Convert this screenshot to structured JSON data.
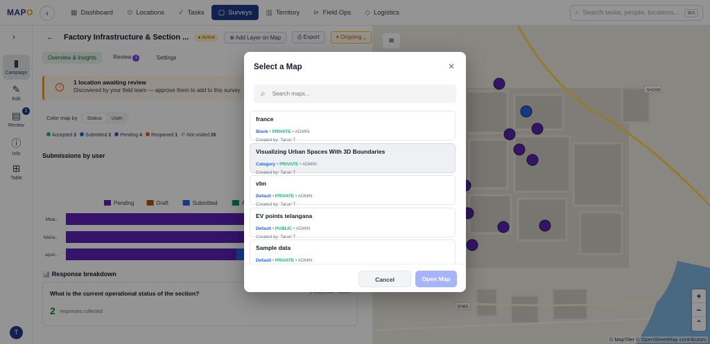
{
  "app": {
    "logo": "MAP",
    "logo_accent": "O"
  },
  "nav": {
    "items": [
      {
        "label": "Dashboard",
        "icon": "dashboard-icon",
        "glyph": "▦"
      },
      {
        "label": "Locations",
        "icon": "pin-icon",
        "glyph": "⊙"
      },
      {
        "label": "Tasks",
        "icon": "tasks-icon",
        "glyph": "✓"
      },
      {
        "label": "Surveys",
        "icon": "clipboard-icon",
        "glyph": "▢"
      },
      {
        "label": "Territory",
        "icon": "map-icon",
        "glyph": "▥"
      },
      {
        "label": "Field Ops",
        "icon": "field-ops-icon",
        "glyph": "⊳"
      },
      {
        "label": "Logistics",
        "icon": "cube-icon",
        "glyph": "◇"
      }
    ],
    "active": "Surveys",
    "search_placeholder": "Search tasks, people, locations...",
    "shortcut": "⌘K"
  },
  "rail": {
    "items": [
      {
        "label": "Campaign",
        "glyph": "▮"
      },
      {
        "label": "Edit",
        "glyph": "✎"
      },
      {
        "label": "Review",
        "glyph": "▤",
        "badge": "1"
      },
      {
        "label": "Info",
        "glyph": "ⓘ"
      },
      {
        "label": "Table",
        "glyph": "⊞"
      }
    ],
    "avatar": "T"
  },
  "survey": {
    "title": "Factory Infrastructure & Section ...",
    "status": "● Active",
    "add_layer": "⊕ Add Layer on Map",
    "export": "⎙ Export",
    "ongoing": "⏸ Ongoing ⌄",
    "tabs": {
      "overview": "Overview & insights",
      "review": "Review",
      "review_count": "1",
      "settings": "Settings"
    },
    "alert_title": "1 location awaiting review",
    "alert_text": "Discovered by your field team — approve them to add to this survey.",
    "color_map_label": "Color map by",
    "color_map_status": "Status",
    "color_map_user": "User",
    "legend": [
      {
        "label": "Accepted",
        "count": "3",
        "color": "#10b981"
      },
      {
        "label": "Submitted",
        "count": "2",
        "color": "#2563eb"
      },
      {
        "label": "Pending",
        "count": "4",
        "color": "#7c3aed"
      },
      {
        "label": "Reopened",
        "count": "1",
        "color": "#ea580c"
      },
      {
        "label": "Not visited",
        "count": "26",
        "color": "#d1d5db"
      }
    ],
    "submissions_title": "Submissions by user",
    "response_title": "📊 Response breakdown",
    "question": "What is the current operational status of the section?",
    "question_meta": "2 responses · select",
    "responses_count": "2",
    "responses_label": "responses collected"
  },
  "chart_data": {
    "type": "bar",
    "orientation": "horizontal",
    "stacked": true,
    "categories": [
      "Mital..",
      "Nisha..",
      "epsri.."
    ],
    "series": [
      {
        "name": "Pending",
        "color": "#5b21b6",
        "values": [
          5,
          5,
          3
        ]
      },
      {
        "name": "Draft",
        "color": "#b45309",
        "values": [
          0,
          0,
          0
        ]
      },
      {
        "name": "Submitted",
        "color": "#2563eb",
        "values": [
          0,
          0,
          1
        ]
      },
      {
        "name": "Accepted",
        "color": "#059669",
        "values": [
          0,
          0,
          0
        ]
      }
    ],
    "x_ticks": [
      "0",
      "1",
      "2",
      "3"
    ],
    "xlim": [
      0,
      5
    ],
    "legend": "top"
  },
  "modal": {
    "title": "Select a Map",
    "search_placeholder": "Search maps...",
    "items": [
      {
        "name": "france",
        "type": "Blank",
        "visibility": "PRIVATE",
        "role": "ADMIN",
        "created": "Created by: Tarun T",
        "selected": false
      },
      {
        "name": "Visualizing Urban Spaces With 3D Boundaries",
        "type": "Category",
        "visibility": "PRIVATE",
        "role": "ADMIN",
        "created": "Created by: Tarun T",
        "selected": true
      },
      {
        "name": "vbn",
        "type": "Default",
        "visibility": "PRIVATE",
        "role": "ADMIN",
        "created": "Created by: Tarun T",
        "selected": false
      },
      {
        "name": "EV points telangana",
        "type": "Default",
        "visibility": "PUBLIC",
        "role": "ADMIN",
        "created": "Created by: Tarun T",
        "selected": false
      },
      {
        "name": "Sample data",
        "type": "Default",
        "visibility": "PRIVATE",
        "role": "ADMIN",
        "created": "Created by: Tarun T",
        "selected": false
      }
    ],
    "cancel": "Cancel",
    "open": "Open Map"
  },
  "map": {
    "attribution": "© MapTiler © OpenStreetMap contributors",
    "road_labels": [
      "SH208",
      "SH85"
    ],
    "zoom_in": "+",
    "zoom_out": "−",
    "compass": "⌃"
  },
  "colors": {
    "brand": "#1e3a8a",
    "pending": "#5b21b6",
    "submitted": "#2563eb",
    "accent": "#a5b4fc"
  }
}
